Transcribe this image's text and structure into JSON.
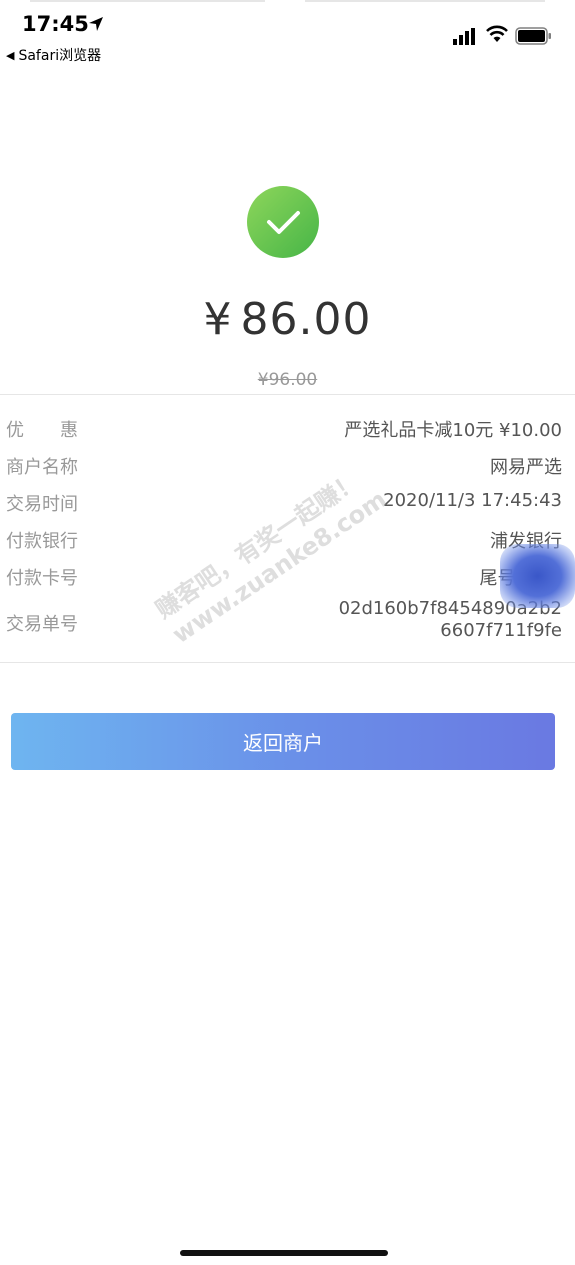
{
  "status_bar": {
    "time": "17:45",
    "back_app": "Safari浏览器",
    "icons": [
      "location-arrow-icon",
      "signal-icon",
      "wifi-icon",
      "battery-icon"
    ]
  },
  "payment": {
    "status_icon": "check-icon",
    "currency": "¥",
    "amount": "86.00",
    "original_amount": "¥96.00",
    "accent_color": "#5fc14e"
  },
  "details": [
    {
      "label": "优惠",
      "value": "严选礼品卡减10元 ¥10.00"
    },
    {
      "label": "商户名称",
      "value": "网易严选"
    },
    {
      "label": "交易时间",
      "value": "2020/11/3 17:45:43"
    },
    {
      "label": "付款银行",
      "value": "浦发银行"
    },
    {
      "label": "付款卡号",
      "value": "尾号2"
    },
    {
      "label": "交易单号",
      "value_line1": "02d160b7f8454890a2b2",
      "value_line2": "6607f711f9fe"
    }
  ],
  "watermark": {
    "line1": "赚客吧，有奖一起赚！",
    "line2": "www.zuanke8.com"
  },
  "actions": {
    "return_label": "返回商户",
    "button_gradient": [
      "#6eb5f0",
      "#6a79e2"
    ]
  }
}
